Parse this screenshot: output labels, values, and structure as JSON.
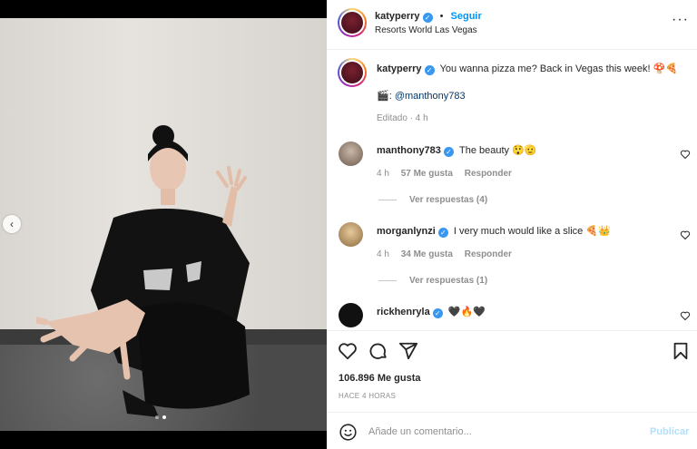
{
  "post": {
    "username": "katyperry",
    "follow_label": "Seguir",
    "location": "Resorts World Las Vegas",
    "caption_user": "katyperry",
    "caption_text": "You wanna pizza me? Back in Vegas this week! 🍄🍕",
    "credit_prefix": "🎬: ",
    "credit_handle": "@manthony783",
    "edited": "Editado · 4 h"
  },
  "comments": [
    {
      "user": "manthony783",
      "text": "The beauty 😲🫡",
      "time": "4 h",
      "likes": "57 Me gusta",
      "reply": "Responder",
      "view_replies": "Ver respuestas (4)"
    },
    {
      "user": "morganlynzi",
      "text": "I very much would like a slice 🍕👑",
      "time": "4 h",
      "likes": "34 Me gusta",
      "reply": "Responder",
      "view_replies": "Ver respuestas (1)"
    },
    {
      "user": "rickhenryla",
      "text": "🖤🔥🖤"
    }
  ],
  "actions": {
    "likes_count": "106.896 Me gusta",
    "timestamp": "HACE 4 HORAS"
  },
  "composer": {
    "placeholder": "Añade un comentario...",
    "publish": "Publicar"
  },
  "icons": [
    "more-icon",
    "heart-icon",
    "comment-icon",
    "share-icon",
    "bookmark-icon",
    "emoji-icon",
    "chevron-left-icon",
    "verified-icon"
  ],
  "colors": {
    "accent": "#0095f6",
    "verified": "#3897f0",
    "link": "#00376b"
  }
}
